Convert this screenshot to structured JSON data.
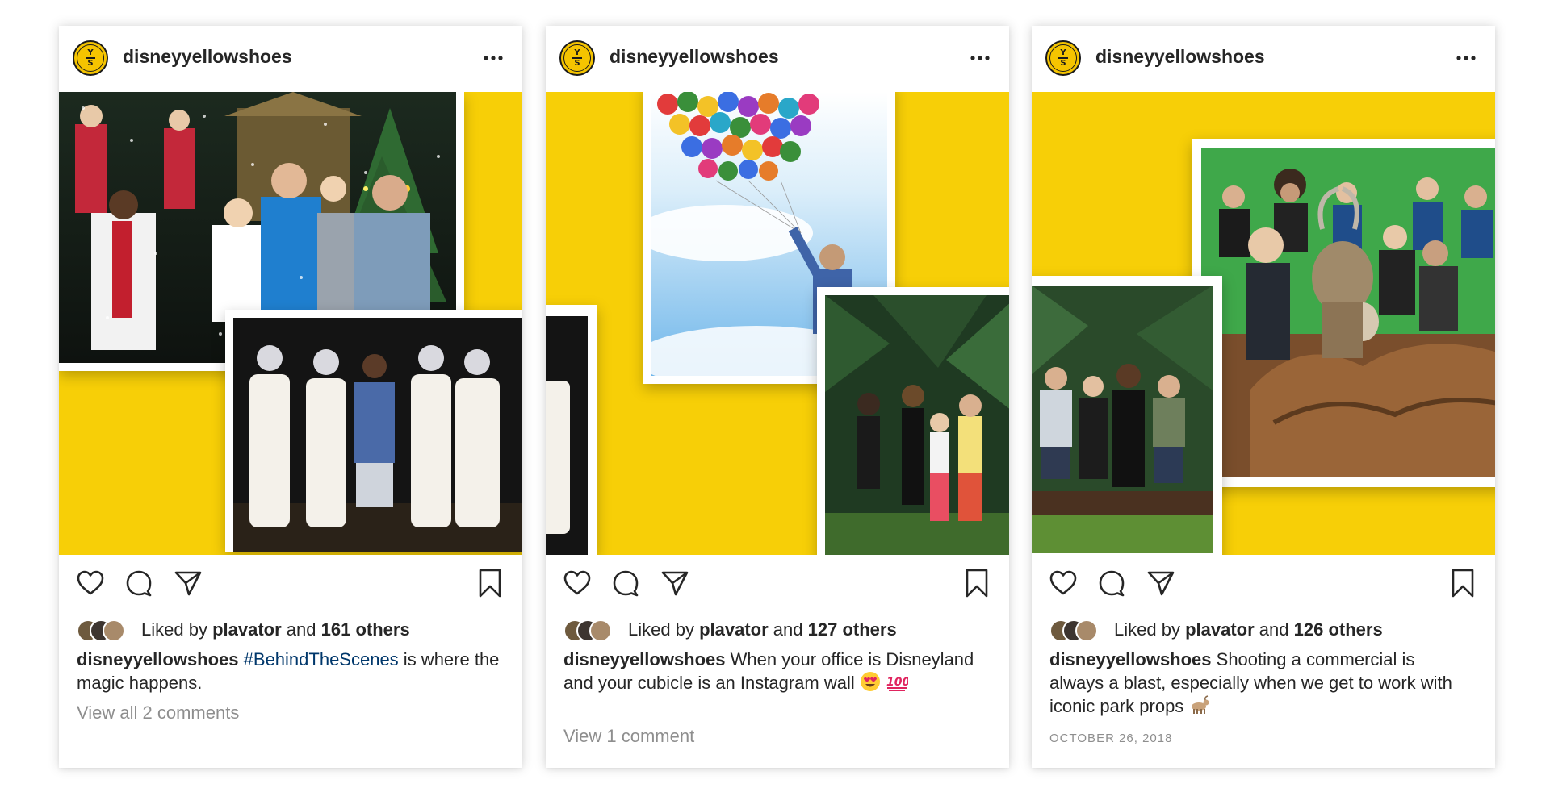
{
  "brand": {
    "yellow": "#f7cf07",
    "avatar_top": "Y",
    "avatar_bottom": "S"
  },
  "posts": [
    {
      "username": "disneyyellowshoes",
      "liked_by_prefix": "Liked by",
      "liked_by_user": "plavator",
      "liked_by_and": "and",
      "liked_by_others": "161 others",
      "caption_user": "disneyyellowshoes",
      "caption_hashtag": "#BehindTheScenes",
      "caption_text": " is where the magic happens.",
      "comments_link": "View all 2 comments"
    },
    {
      "username": "disneyyellowshoes",
      "liked_by_prefix": "Liked by",
      "liked_by_user": "plavator",
      "liked_by_and": "and",
      "liked_by_others": "127 others",
      "caption_user": "disneyyellowshoes",
      "caption_text": " When your office is Disneyland and your cubicle is an Instagram wall",
      "caption_emojis": [
        "heart-eyes-emoji",
        "hundred-points-emoji"
      ],
      "comments_link": "View 1 comment"
    },
    {
      "username": "disneyyellowshoes",
      "liked_by_prefix": "Liked by",
      "liked_by_user": "plavator",
      "liked_by_and": "and",
      "liked_by_others": "126 others",
      "caption_user": "disneyyellowshoes",
      "caption_text": " Shooting a commercial is always a blast, especially when we get to work with iconic park props",
      "caption_emojis": [
        "goat-emoji"
      ],
      "date": "OCTOBER 26, 2018"
    }
  ],
  "icons": [
    "heart-icon",
    "comment-icon",
    "share-icon",
    "bookmark-icon",
    "more-options-icon"
  ]
}
